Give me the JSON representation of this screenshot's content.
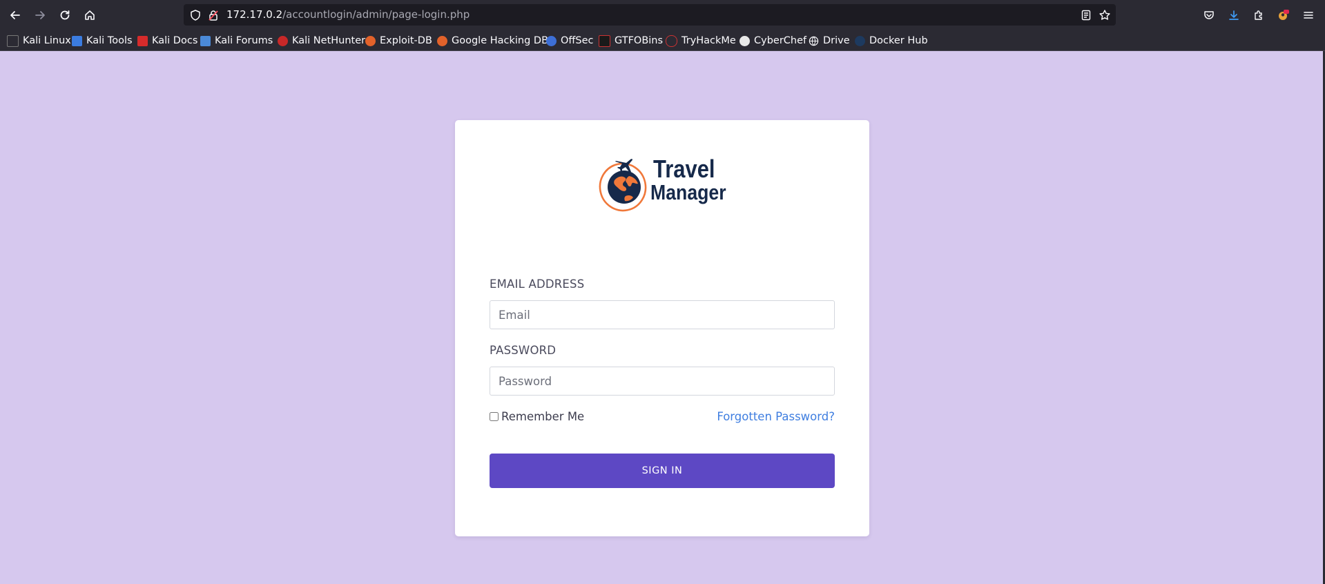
{
  "browser": {
    "url_host": "172.17.0.2",
    "url_path": "/accountlogin/admin/page-login.php",
    "bookmarks": [
      {
        "label": "Kali Linux",
        "icon": "kali-dragon-icon"
      },
      {
        "label": "Kali Tools",
        "icon": "kali-tools-icon"
      },
      {
        "label": "Kali Docs",
        "icon": "kali-docs-icon"
      },
      {
        "label": "Kali Forums",
        "icon": "kali-forums-icon"
      },
      {
        "label": "Kali NetHunter",
        "icon": "kali-nethunter-icon"
      },
      {
        "label": "Exploit-DB",
        "icon": "exploit-db-icon"
      },
      {
        "label": "Google Hacking DB",
        "icon": "google-hacking-db-icon"
      },
      {
        "label": "OffSec",
        "icon": "offsec-icon"
      },
      {
        "label": "GTFOBins",
        "icon": "gtfobins-icon"
      },
      {
        "label": "TryHackMe",
        "icon": "tryhackme-icon"
      },
      {
        "label": "CyberChef",
        "icon": "cyberchef-icon"
      },
      {
        "label": "Drive",
        "icon": "globe-icon"
      },
      {
        "label": "Docker Hub",
        "icon": "docker-hub-icon"
      }
    ]
  },
  "login": {
    "logo_line1": "Travel",
    "logo_line2": "Manager",
    "email_label": "EMAIL ADDRESS",
    "email_placeholder": "Email",
    "password_label": "PASSWORD",
    "password_placeholder": "Password",
    "remember_label": "Remember Me",
    "forgot_label": "Forgotten Password?",
    "signin_label": "SIGN IN"
  },
  "colors": {
    "page_background": "#d6c8ee",
    "primary_button": "#5d48c4",
    "link": "#3f7ee0",
    "logo_navy": "#16294a",
    "logo_orange": "#f0783a"
  }
}
